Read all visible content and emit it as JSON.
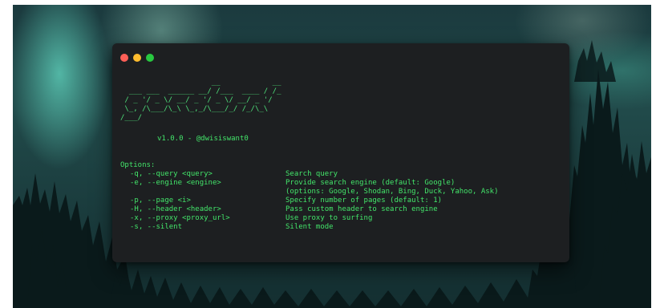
{
  "window": {
    "traffic_lights": [
      {
        "name": "close",
        "color": "#fe5f57"
      },
      {
        "name": "minimize",
        "color": "#febc2e"
      },
      {
        "name": "zoom",
        "color": "#28c840"
      }
    ]
  },
  "terminal": {
    "ascii_logo": [
      "                     __            __",
      "  ___ ___  ______ __/ /___  ____ / /_",
      " / _ '/ _ \\/ __/ _ '/ _ \\/ __/ _ '/",
      " \\_, /\\___/\\_\\ \\_,_/\\___/_/ /_/\\_\\",
      "/___/"
    ],
    "version_line": "v1.0.0 - @dwisiswant0",
    "options_title": "Options:",
    "options": [
      {
        "flag": "-q, --query <query>",
        "desc": "Search query"
      },
      {
        "flag": "-e, --engine <engine>",
        "desc": "Provide search engine (default: Google)"
      },
      {
        "flag": "",
        "desc": "(options: Google, Shodan, Bing, Duck, Yahoo, Ask)"
      },
      {
        "flag": "-p, --page <i>",
        "desc": "Specify number of pages (default: 1)"
      },
      {
        "flag": "-H, --header <header>",
        "desc": "Pass custom header to search engine"
      },
      {
        "flag": "-x, --proxy <proxy_url>",
        "desc": "Use proxy to surfing"
      },
      {
        "flag": "-s, --silent",
        "desc": "Silent mode"
      }
    ]
  },
  "colors": {
    "terminal_bg": "#1d1f21",
    "text_green": "#43e56a",
    "aurora": "#68e6cd"
  }
}
